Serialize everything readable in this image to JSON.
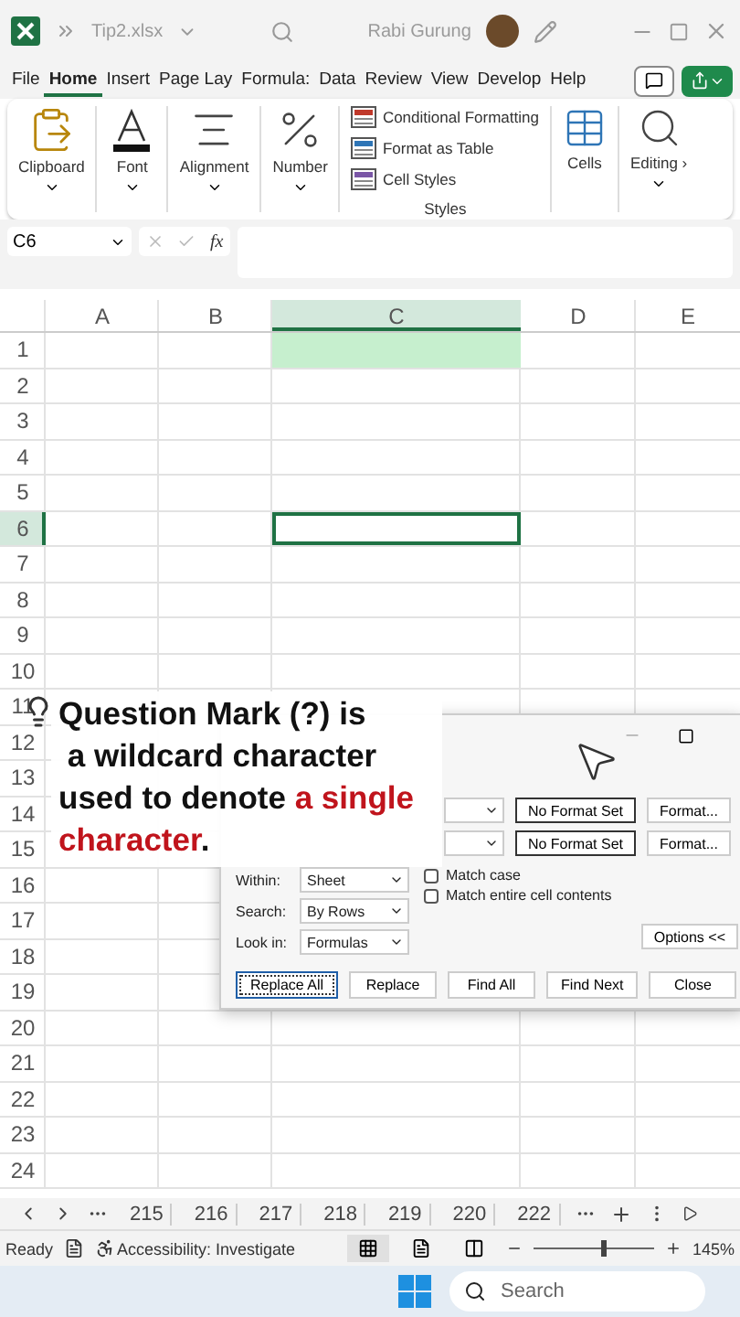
{
  "window": {
    "file_name": "Tip2.xlsx",
    "user_name": "Rabi Gurung"
  },
  "menu_tabs": [
    {
      "label": "File",
      "selected": false
    },
    {
      "label": "Home",
      "selected": true
    },
    {
      "label": "Insert",
      "selected": false
    },
    {
      "label": "Page Lay",
      "selected": false
    },
    {
      "label": "Formula:",
      "selected": false
    },
    {
      "label": "Data",
      "selected": false
    },
    {
      "label": "Review",
      "selected": false
    },
    {
      "label": "View",
      "selected": false
    },
    {
      "label": "Develop",
      "selected": false
    },
    {
      "label": "Help",
      "selected": false
    }
  ],
  "ribbon": {
    "groups": [
      {
        "kind": "clipboard",
        "label": "Clipboard"
      },
      {
        "kind": "font",
        "label": "Font"
      },
      {
        "kind": "alignment",
        "label": "Alignment"
      },
      {
        "kind": "number",
        "label": "Number"
      }
    ],
    "styles": {
      "label": "Styles",
      "items": [
        {
          "kind": "conditional",
          "label": "Conditional Formatting"
        },
        {
          "kind": "table",
          "label": "Format as Table"
        },
        {
          "kind": "cell",
          "label": "Cell Styles"
        }
      ]
    },
    "cells": {
      "label": "Cells"
    },
    "editing": {
      "label": "Editing ›"
    }
  },
  "formula_bar": {
    "name_box": "C6",
    "function_symbol": "fx"
  },
  "sheet": {
    "columns": [
      {
        "label": "A",
        "selected": false
      },
      {
        "label": "B",
        "selected": false
      },
      {
        "label": "C",
        "selected": true
      },
      {
        "label": "D",
        "selected": false
      },
      {
        "label": "E",
        "selected": false
      }
    ],
    "rows": [
      {
        "label": "1",
        "selected": false,
        "shaded": true
      },
      {
        "label": "2",
        "selected": false,
        "shaded": false
      },
      {
        "label": "3",
        "selected": false,
        "shaded": false
      },
      {
        "label": "4",
        "selected": false,
        "shaded": false
      },
      {
        "label": "5",
        "selected": false,
        "shaded": false
      },
      {
        "label": "6",
        "selected": true,
        "shaded": false
      },
      {
        "label": "7",
        "selected": false,
        "shaded": false
      },
      {
        "label": "8",
        "selected": false,
        "shaded": false
      },
      {
        "label": "9",
        "selected": false,
        "shaded": false
      },
      {
        "label": "10",
        "selected": false,
        "shaded": false
      },
      {
        "label": "11",
        "selected": false,
        "shaded": false
      },
      {
        "label": "12",
        "selected": false,
        "shaded": false
      },
      {
        "label": "13",
        "selected": false,
        "shaded": false
      },
      {
        "label": "14",
        "selected": false,
        "shaded": false
      },
      {
        "label": "15",
        "selected": false,
        "shaded": false
      },
      {
        "label": "16",
        "selected": false,
        "shaded": false
      },
      {
        "label": "17",
        "selected": false,
        "shaded": false
      },
      {
        "label": "18",
        "selected": false,
        "shaded": false
      },
      {
        "label": "19",
        "selected": false,
        "shaded": false
      },
      {
        "label": "20",
        "selected": false,
        "shaded": false
      },
      {
        "label": "21",
        "selected": false,
        "shaded": false
      },
      {
        "label": "22",
        "selected": false,
        "shaded": false
      },
      {
        "label": "23",
        "selected": false,
        "shaded": false
      },
      {
        "label": "24",
        "selected": false,
        "shaded": false
      }
    ]
  },
  "dialog": {
    "format_rows": [
      {
        "status": "No Format Set",
        "button": "Format..."
      },
      {
        "status": "No Format Set",
        "button": "Format..."
      }
    ],
    "selects": [
      {
        "label": "Within:",
        "value": "Sheet"
      },
      {
        "label": "Search:",
        "value": "By Rows"
      },
      {
        "label": "Look in:",
        "value": "Formulas"
      }
    ],
    "checkboxes": [
      {
        "label": "Match case",
        "checked": false
      },
      {
        "label": "Match entire cell contents",
        "checked": false
      }
    ],
    "options_button": "Options <<",
    "buttons": [
      {
        "label": "Replace All",
        "selected": true
      },
      {
        "label": "Replace",
        "selected": false
      },
      {
        "label": "Find All",
        "selected": false
      },
      {
        "label": "Find Next",
        "selected": false
      },
      {
        "label": "Close",
        "selected": false
      }
    ]
  },
  "caption": {
    "lines": [
      [
        {
          "text": "Question Mark (?) is",
          "highlight": false
        }
      ],
      [
        {
          "text": " a wildcard character",
          "highlight": false
        }
      ],
      [
        {
          "text": "used to denote ",
          "highlight": false
        },
        {
          "text": "a single",
          "highlight": true
        }
      ],
      [
        {
          "text": "character",
          "highlight": true
        },
        {
          "text": ".",
          "highlight": false
        }
      ]
    ]
  },
  "sheet_tabs": [
    {
      "label": "215",
      "selected": false
    },
    {
      "label": "216",
      "selected": false
    },
    {
      "label": "217",
      "selected": false
    },
    {
      "label": "218",
      "selected": false
    },
    {
      "label": "219",
      "selected": false
    },
    {
      "label": "220",
      "selected": false
    },
    {
      "label": "222",
      "selected": false
    }
  ],
  "status_bar": {
    "status": "Ready",
    "accessibility": "Accessibility: Investigate",
    "zoom": {
      "level": 0.58,
      "reading": "145%"
    }
  },
  "taskbar": {
    "search_placeholder": "Search"
  }
}
